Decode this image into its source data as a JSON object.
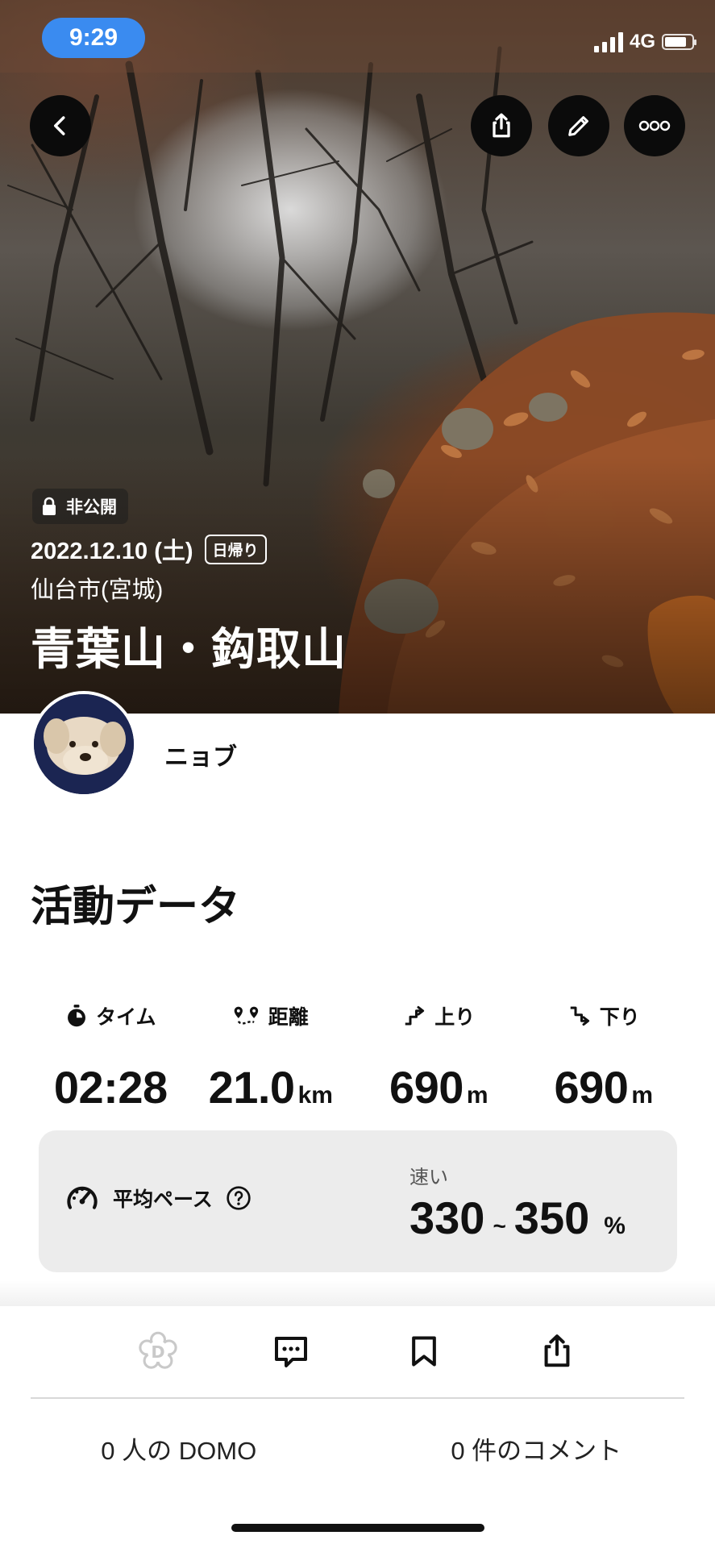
{
  "status_bar": {
    "time": "9:29",
    "network": "4G"
  },
  "hero": {
    "private_label": "非公開",
    "date": "2022.12.10 (土)",
    "trip_type": "日帰り",
    "location": "仙台市(宮城)",
    "title": "青葉山・鈎取山"
  },
  "user": {
    "name": "ニョブ"
  },
  "activity": {
    "section_title": "活動データ",
    "stats": [
      {
        "label": "タイム",
        "value": "02:28",
        "unit": "",
        "icon": "stopwatch-icon"
      },
      {
        "label": "距離",
        "value": "21.0",
        "unit": "km",
        "icon": "route-icon"
      },
      {
        "label": "上り",
        "value": "690",
        "unit": "m",
        "icon": "ascent-icon"
      },
      {
        "label": "下り",
        "value": "690",
        "unit": "m",
        "icon": "descent-icon"
      }
    ],
    "pace": {
      "label": "平均ペース",
      "speed_label": "速い",
      "min": "330",
      "tilde": "~",
      "max": "350",
      "unit": "%"
    }
  },
  "actions": {
    "icons": [
      "domo-icon",
      "comment-icon",
      "bookmark-icon",
      "share-icon"
    ]
  },
  "counts": {
    "domo": "0 人の DOMO",
    "comments": "0 件のコメント"
  },
  "colors": {
    "status_pill": "#3a8bf0",
    "card_bg": "#ececec"
  }
}
